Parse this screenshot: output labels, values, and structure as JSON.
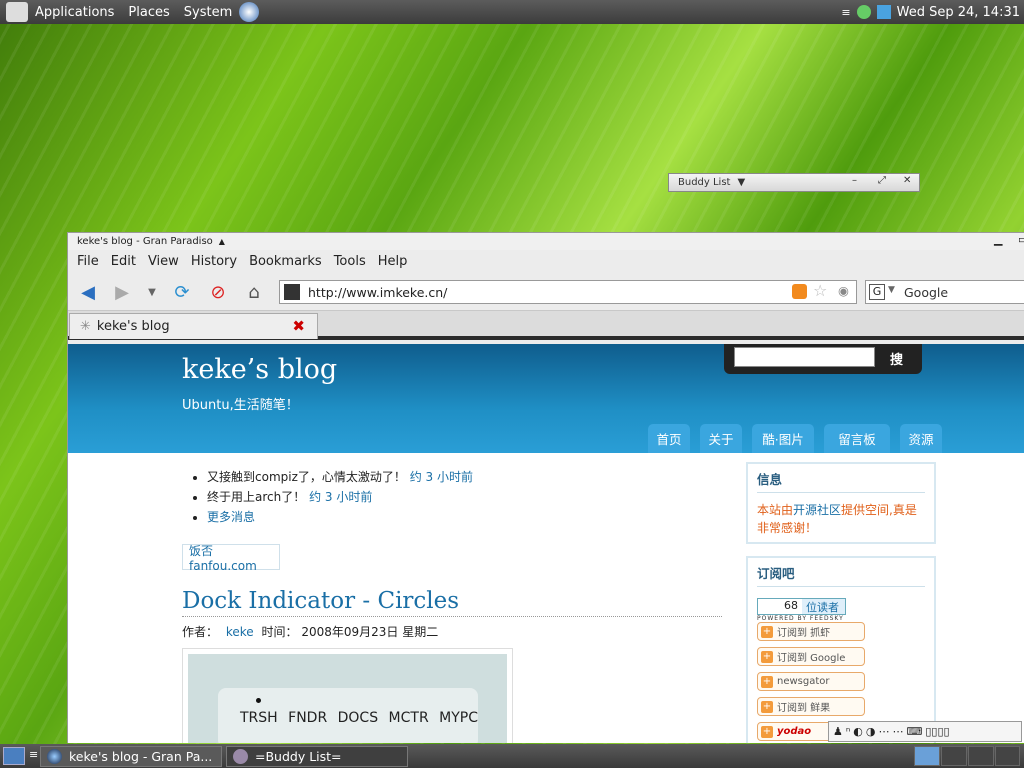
{
  "top_panel": {
    "applications": "Applications",
    "places": "Places",
    "system": "System",
    "clock": "Wed Sep 24, 14:31"
  },
  "buddy_list": {
    "title": "Buddy List"
  },
  "browser": {
    "window_title": "keke's blog - Gran Paradiso",
    "menu": [
      "File",
      "Edit",
      "View",
      "History",
      "Bookmarks",
      "Tools",
      "Help"
    ],
    "url": "http://www.imkeke.cn/",
    "search_engine": "Google",
    "tab_label": "keke's blog"
  },
  "blog": {
    "title": "keke’s blog",
    "tagline": "Ubuntu,生活随笔！",
    "search_button": "搜",
    "nav": [
      "首页",
      "关于",
      "酷·图片",
      "留言板",
      "资源"
    ],
    "updates": [
      {
        "text": "又接触到compiz了，心情太激动了！",
        "time": "约 3 小时前"
      },
      {
        "text": "终于用上arch了！",
        "time": "约 3 小时前"
      },
      {
        "text": "更多消息",
        "time": ""
      }
    ],
    "fanfou": "饭否 fanfou.com",
    "post_title": "Dock Indicator - Circles",
    "post_meta": {
      "author_label": "作者：",
      "author": "keke",
      "time_label": "时间：",
      "date": "2008年09月23日 星期二"
    },
    "post_image_labels": "TRSH FNDR DOCS MCTR MYPC",
    "sidebar": {
      "info_title": "信息",
      "info_text_pre": "本站由",
      "info_link": "开源社区",
      "info_text_post": "提供空间,真是非常感谢！",
      "subscribe_title": "订阅吧",
      "reader_count": "68",
      "reader_label": "位读者",
      "powered": "POWERED BY FEEDSKY",
      "sub_buttons": [
        "订阅到 抓虾",
        "订阅到 Google",
        "newsgator",
        "订阅到 鲜果",
        "yodao"
      ]
    }
  },
  "taskbar": {
    "task1": "keke's blog - Gran Pa...",
    "task2": "=Buddy List="
  }
}
